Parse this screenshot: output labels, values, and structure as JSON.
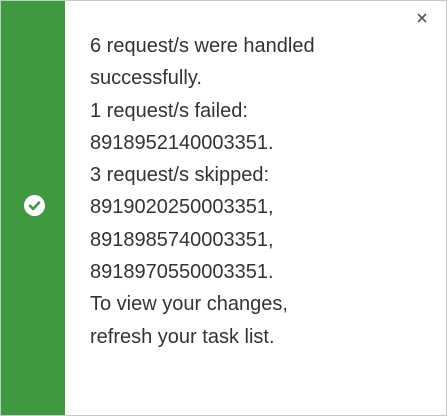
{
  "notification": {
    "status": "success",
    "accent_color": "#3f9a3f",
    "status_icon": "check-circle-icon",
    "close_icon": "close-icon",
    "lines": [
      "6 request/s were handled",
      "successfully.",
      "1 request/s failed:",
      "8918952140003351.",
      "3 request/s skipped:",
      "8919020250003351,",
      "8918985740003351,",
      "8918970550003351.",
      "To view your changes,",
      "refresh your task list."
    ]
  }
}
